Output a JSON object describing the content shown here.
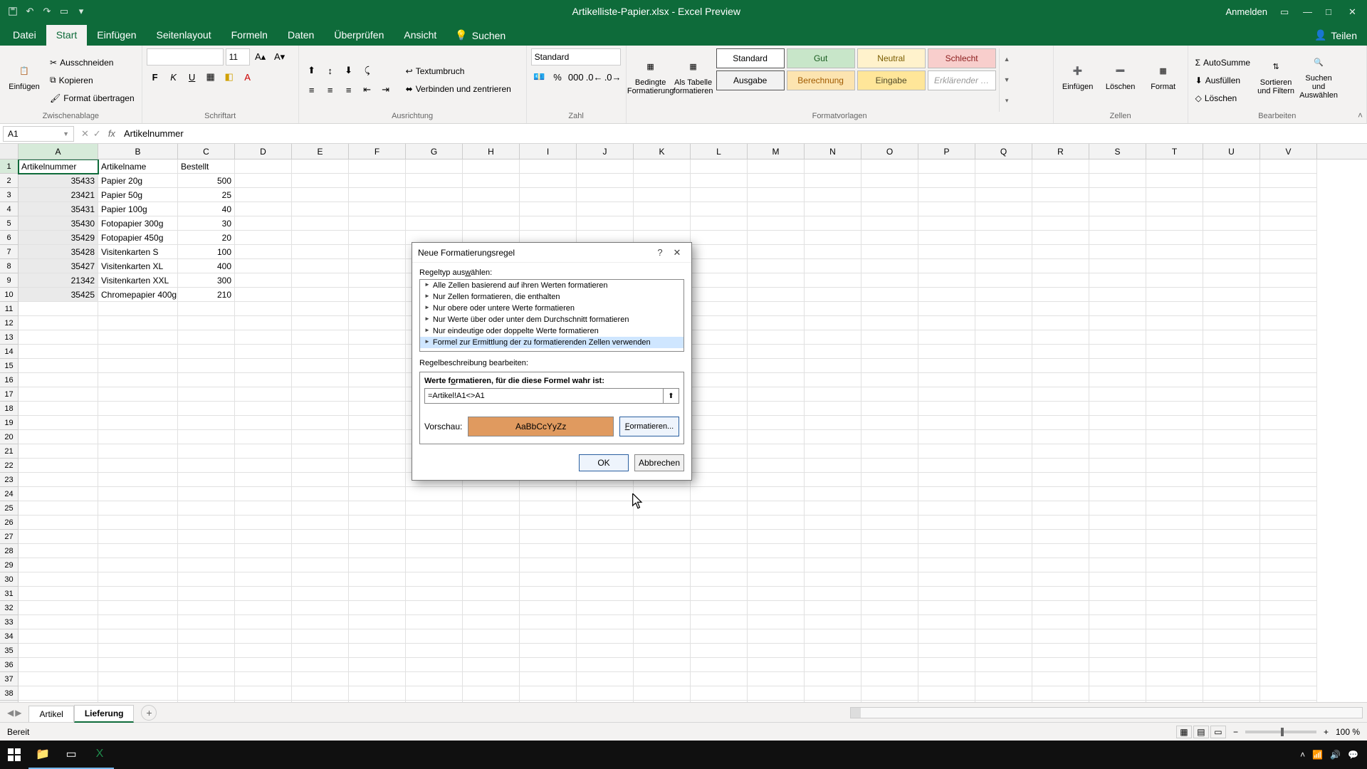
{
  "titlebar": {
    "filename": "Artikelliste-Papier.xlsx  -  Excel Preview",
    "signin": "Anmelden"
  },
  "tabs": {
    "datei": "Datei",
    "start": "Start",
    "einfuegen": "Einfügen",
    "seitenlayout": "Seitenlayout",
    "formeln": "Formeln",
    "daten": "Daten",
    "ueberpruefen": "Überprüfen",
    "ansicht": "Ansicht",
    "suchen": "Suchen",
    "teilen": "Teilen"
  },
  "ribbon": {
    "clipboard": {
      "paste": "Einfügen",
      "cut": "Ausschneiden",
      "copy": "Kopieren",
      "painter": "Format übertragen",
      "title": "Zwischenablage"
    },
    "font": {
      "size": "11",
      "title": "Schriftart"
    },
    "align": {
      "wrap": "Textumbruch",
      "merge": "Verbinden und zentrieren",
      "title": "Ausrichtung"
    },
    "number": {
      "format": "Standard",
      "title": "Zahl"
    },
    "styles": {
      "cond": "Bedingte Formatierung",
      "table": "Als Tabelle formatieren",
      "s1": "Standard",
      "s2": "Gut",
      "s3": "Neutral",
      "s4": "Schlecht",
      "s5": "Ausgabe",
      "s6": "Berechnung",
      "s7": "Eingabe",
      "s8": "Erklärender …",
      "title": "Formatvorlagen"
    },
    "cells": {
      "insert": "Einfügen",
      "delete": "Löschen",
      "format": "Format",
      "title": "Zellen"
    },
    "editing": {
      "autosum": "AutoSumme",
      "fill": "Ausfüllen",
      "clear": "Löschen",
      "sortfilter": "Sortieren und Filtern",
      "findselect": "Suchen und Auswählen",
      "title": "Bearbeiten"
    }
  },
  "formula_bar": {
    "name_box": "A1",
    "formula": "Artikelnummer"
  },
  "columns": [
    "A",
    "B",
    "C",
    "D",
    "E",
    "F",
    "G",
    "H",
    "I",
    "J",
    "K",
    "L",
    "M",
    "N",
    "O",
    "P",
    "Q",
    "R",
    "S",
    "T",
    "U",
    "V"
  ],
  "data_rows": [
    {
      "a": "Artikelnummer",
      "b": "Artikelname",
      "c": "Bestellt"
    },
    {
      "a": "35433",
      "b": "Papier 20g",
      "c": "500"
    },
    {
      "a": "23421",
      "b": "Papier 50g",
      "c": "25"
    },
    {
      "a": "35431",
      "b": "Papier 100g",
      "c": "40"
    },
    {
      "a": "35430",
      "b": "Fotopapier 300g",
      "c": "30"
    },
    {
      "a": "35429",
      "b": "Fotopapier 450g",
      "c": "20"
    },
    {
      "a": "35428",
      "b": "Visitenkarten S",
      "c": "100"
    },
    {
      "a": "35427",
      "b": "Visitenkarten XL",
      "c": "400"
    },
    {
      "a": "21342",
      "b": "Visitenkarten XXL",
      "c": "300"
    },
    {
      "a": "35425",
      "b": "Chromepapier 400g",
      "c": "210"
    }
  ],
  "sheets": {
    "s1": "Artikel",
    "s2": "Lieferung"
  },
  "status": {
    "ready": "Bereit",
    "zoom": "100 %"
  },
  "dialog": {
    "title": "Neue Formatierungsregel",
    "ruletype_label_pre": "Regeltyp aus",
    "ruletype_label_accel": "w",
    "ruletype_label_post": "ählen:",
    "r1": "Alle Zellen basierend auf ihren Werten formatieren",
    "r2": "Nur Zellen formatieren, die enthalten",
    "r3": "Nur obere oder untere Werte formatieren",
    "r4": "Nur Werte über oder unter dem Durchschnitt formatieren",
    "r5": "Nur eindeutige oder doppelte Werte formatieren",
    "r6": "Formel zur Ermittlung der zu formatierenden Zellen verwenden",
    "desc_label": "Regelbeschreibung bearbeiten:",
    "formula_label_pre": "Werte f",
    "formula_label_accel": "o",
    "formula_label_post": "rmatieren, für die diese Formel wahr ist:",
    "formula_value": "=Artikel!A1<>A1",
    "preview_label": "Vorschau:",
    "preview_text": "AaBbCcYyZz",
    "format_btn_accel": "F",
    "format_btn_post": "ormatieren...",
    "ok": "OK",
    "cancel": "Abbrechen"
  }
}
